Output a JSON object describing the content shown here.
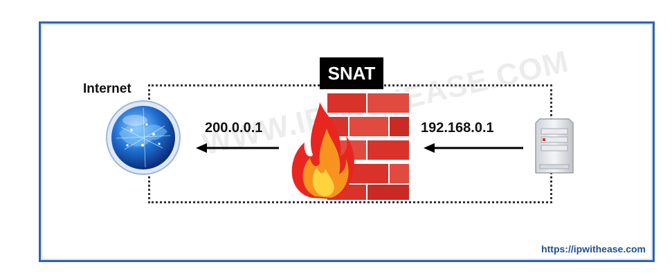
{
  "diagram": {
    "title": "SNAT",
    "internet_label": "Internet",
    "public_ip": "200.0.0.1",
    "private_ip": "192.168.0.1",
    "watermark": "WWW.IPWITHEASE.COM",
    "url": "https://ipwithease.com"
  },
  "colors": {
    "frame": "#2f63b2",
    "brick": "#d9322b",
    "flame": "#f7941d",
    "globe": "#1f6fd1"
  },
  "icons": [
    "globe-icon",
    "firewall-icon",
    "server-icon"
  ]
}
